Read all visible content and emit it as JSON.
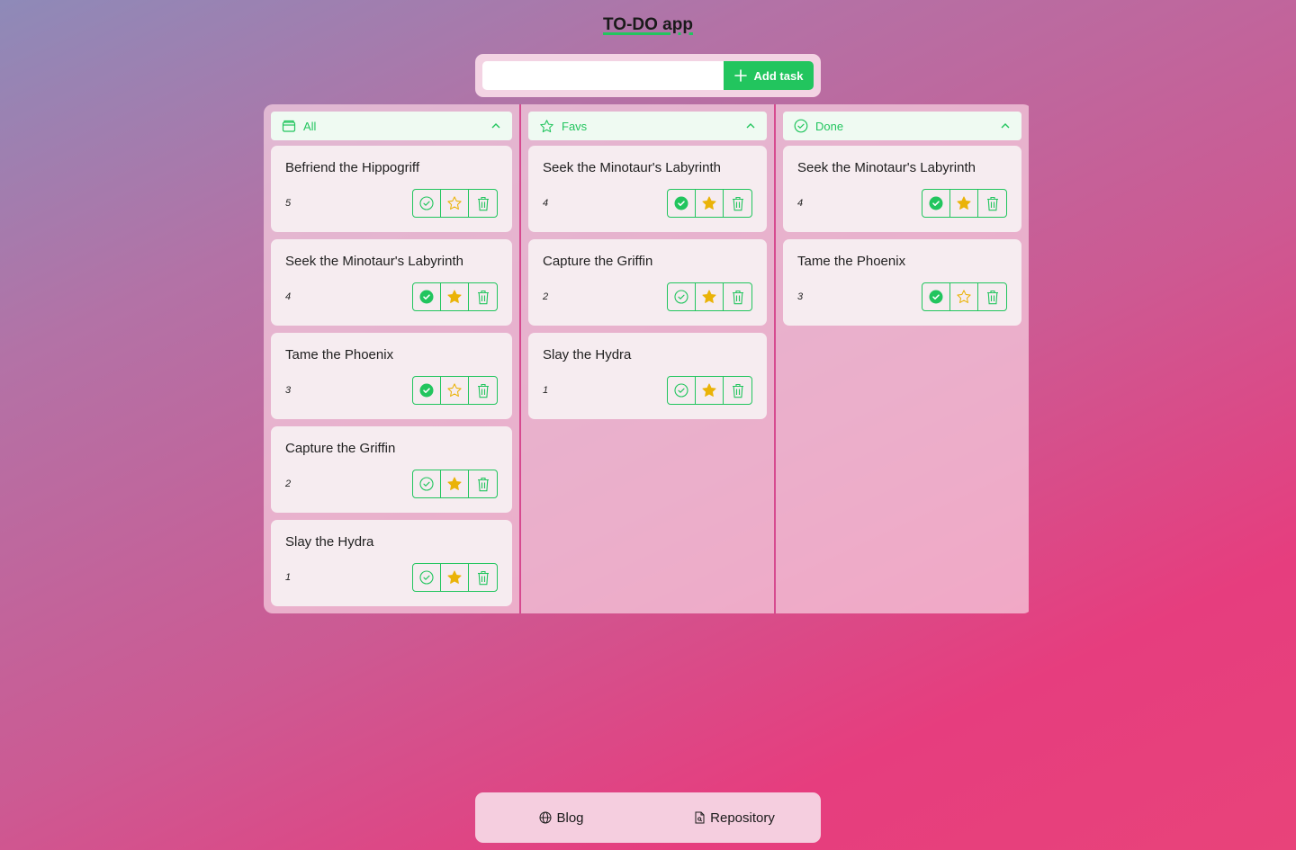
{
  "app": {
    "title": "TO-DO app"
  },
  "input": {
    "value": "",
    "placeholder": "",
    "add_label": "Add task"
  },
  "colors": {
    "accent": "#22c55e",
    "star": "#eab308",
    "divider": "#d64a8f"
  },
  "columns": [
    {
      "key": "all",
      "label": "All",
      "icon": "folder-icon",
      "cards": [
        {
          "title": "Befriend the Hippogriff",
          "num": "5",
          "done": false,
          "fav": false
        },
        {
          "title": "Seek the Minotaur's Labyrinth",
          "num": "4",
          "done": true,
          "fav": true
        },
        {
          "title": "Tame the Phoenix",
          "num": "3",
          "done": true,
          "fav": false
        },
        {
          "title": "Capture the Griffin",
          "num": "2",
          "done": false,
          "fav": true
        },
        {
          "title": "Slay the Hydra",
          "num": "1",
          "done": false,
          "fav": true
        }
      ]
    },
    {
      "key": "favs",
      "label": "Favs",
      "icon": "star-icon",
      "cards": [
        {
          "title": "Seek the Minotaur's Labyrinth",
          "num": "4",
          "done": true,
          "fav": true
        },
        {
          "title": "Capture the Griffin",
          "num": "2",
          "done": false,
          "fav": true
        },
        {
          "title": "Slay the Hydra",
          "num": "1",
          "done": false,
          "fav": true
        }
      ]
    },
    {
      "key": "done",
      "label": "Done",
      "icon": "check-circle-icon",
      "cards": [
        {
          "title": "Seek the Minotaur's Labyrinth",
          "num": "4",
          "done": true,
          "fav": true
        },
        {
          "title": "Tame the Phoenix",
          "num": "3",
          "done": true,
          "fav": false
        }
      ]
    }
  ],
  "footer": {
    "blog_label": "Blog",
    "repo_label": "Repository"
  }
}
